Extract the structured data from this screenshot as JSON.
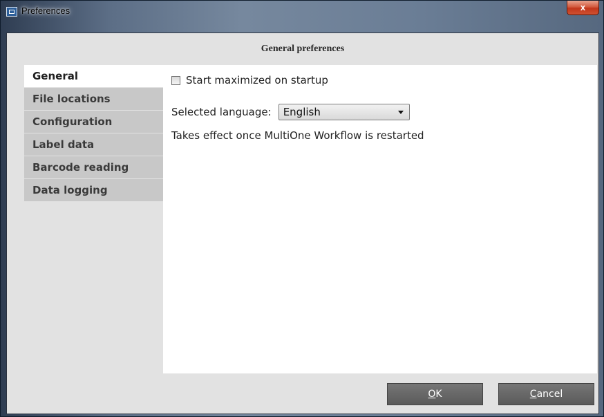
{
  "window": {
    "title": "Preferences",
    "close_label": "x"
  },
  "header": {
    "title": "General preferences"
  },
  "sidebar": {
    "items": [
      {
        "label": "General",
        "active": true
      },
      {
        "label": "File locations",
        "active": false
      },
      {
        "label": "Configuration",
        "active": false
      },
      {
        "label": "Label data",
        "active": false
      },
      {
        "label": "Barcode reading",
        "active": false
      },
      {
        "label": "Data logging",
        "active": false
      }
    ]
  },
  "general": {
    "start_maximized_label": "Start maximized on startup",
    "start_maximized_checked": false,
    "language_label": "Selected language:",
    "language_value": "English",
    "restart_note": "Takes effect once MultiOne Workflow is restarted"
  },
  "buttons": {
    "ok_mnemonic": "O",
    "ok_rest": "K",
    "cancel_mnemonic": "C",
    "cancel_rest": "ancel"
  }
}
